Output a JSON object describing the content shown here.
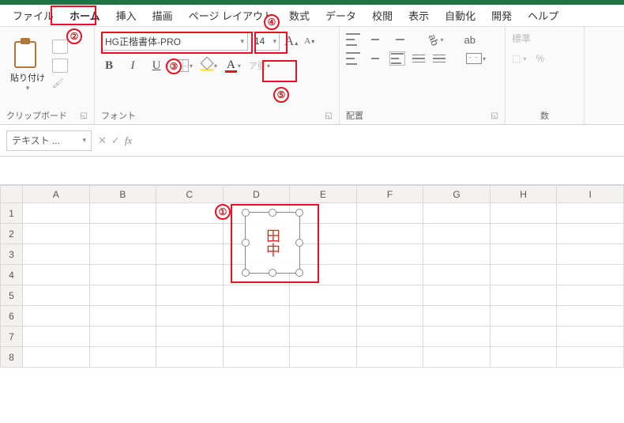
{
  "menu": {
    "file": "ファイル",
    "home": "ホーム",
    "insert": "挿入",
    "draw": "描画",
    "pagelayout": "ページ レイアウト",
    "formulas": "数式",
    "data": "データ",
    "review": "校閲",
    "view": "表示",
    "automate": "自動化",
    "developer": "開発",
    "help": "ヘルプ"
  },
  "ribbon": {
    "clipboard": {
      "paste": "貼り付け",
      "group": "クリップボード"
    },
    "font": {
      "name": "HG正楷書体-PRO",
      "size": "14",
      "group": "フォント",
      "bold": "B",
      "italic": "I",
      "underline": "U",
      "fontcolor_letter": "A",
      "ruby": "ア亜"
    },
    "align": {
      "group": "配置",
      "wrap": "ab"
    },
    "number": {
      "style": "標準",
      "currency": "%",
      "group": "数"
    }
  },
  "formula_bar": {
    "name_box": "テキスト ...",
    "cancel": "✕",
    "confirm": "✓",
    "fx": "fx"
  },
  "columns": [
    "A",
    "B",
    "C",
    "D",
    "E",
    "F",
    "G",
    "H",
    "I"
  ],
  "rows": [
    "1",
    "2",
    "3",
    "4",
    "5",
    "6",
    "7",
    "8"
  ],
  "selected_col": "F",
  "textbox": {
    "text": "田中"
  },
  "annotations": {
    "n1": "①",
    "n2": "②",
    "n3": "③",
    "n4": "④",
    "n5": "⑤"
  }
}
